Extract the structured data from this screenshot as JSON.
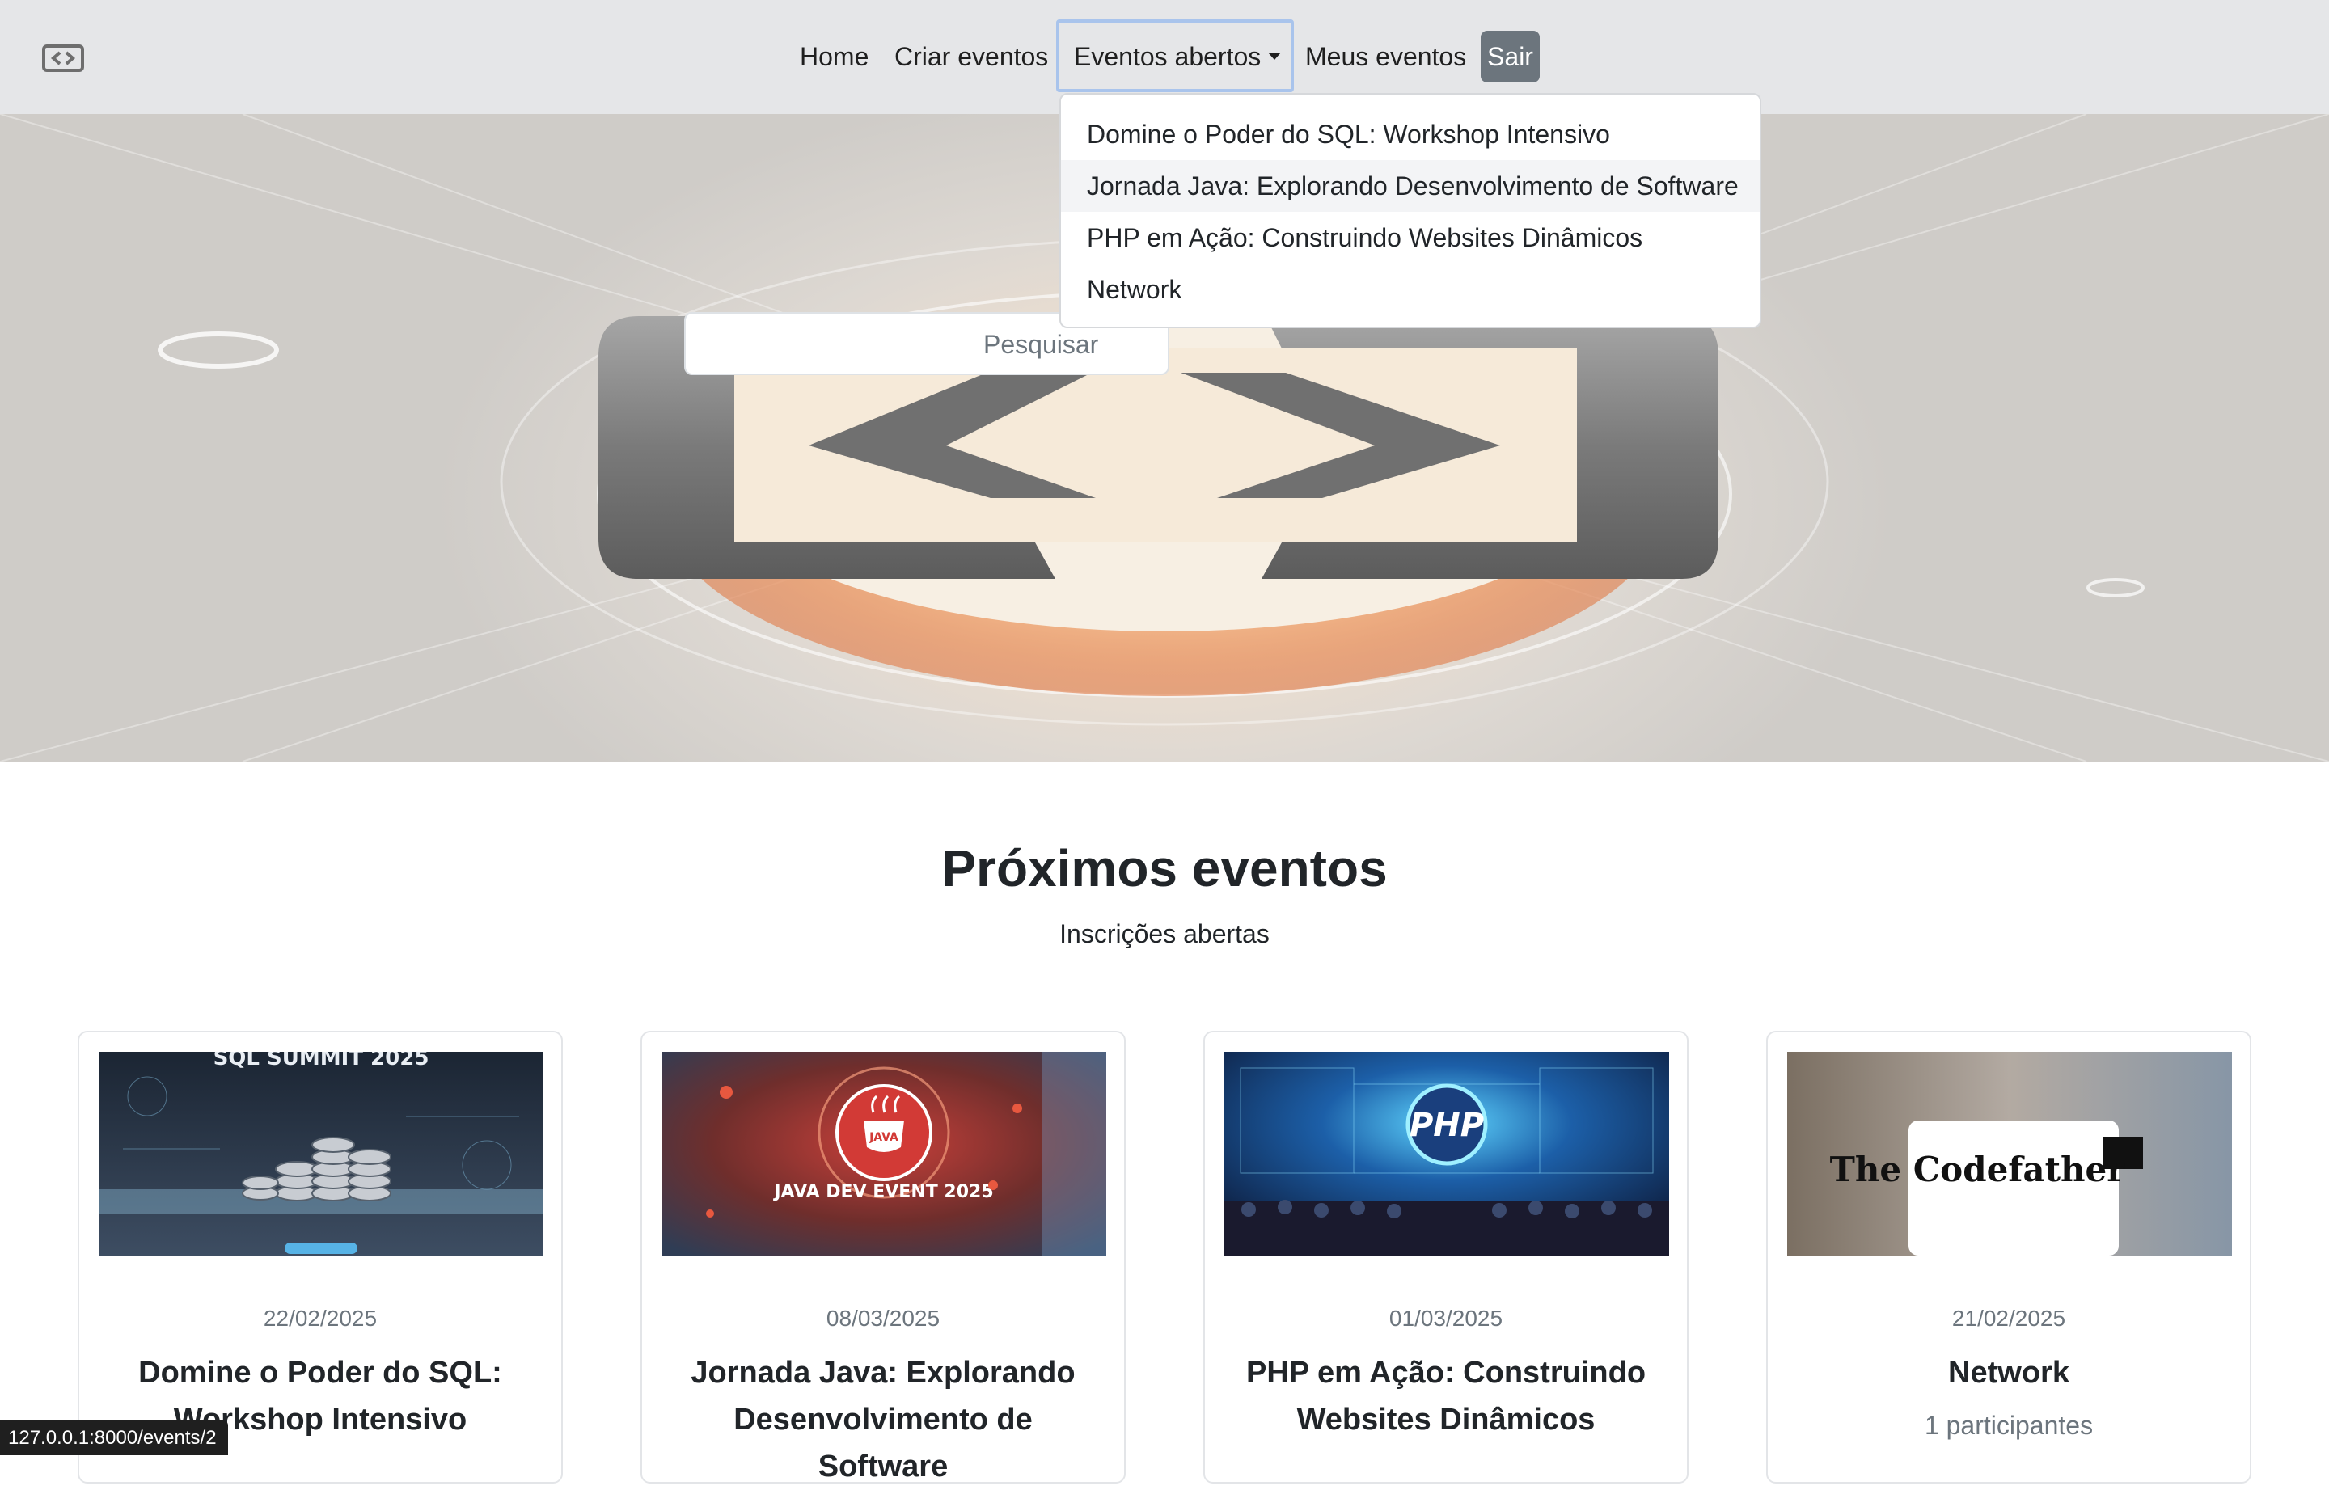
{
  "nav": {
    "logo_icon": "code-brackets-icon",
    "links": [
      {
        "label": "Home"
      },
      {
        "label": "Criar eventos"
      },
      {
        "label": "Meus eventos"
      }
    ],
    "dropdown_label": "Eventos abertos",
    "logout_label": "Sair"
  },
  "dropdown": {
    "items": [
      {
        "label": "Domine o Poder do SQL: Workshop Intensivo"
      },
      {
        "label": "Jornada Java: Explorando Desenvolvimento de Software"
      },
      {
        "label": "PHP em Ação: Construindo Websites Dinâmicos"
      },
      {
        "label": "Network"
      }
    ]
  },
  "hero": {
    "search_placeholder": "Pesquisar"
  },
  "section": {
    "title": "Próximos eventos",
    "subtitle": "Inscrições abertas"
  },
  "events": [
    {
      "date": "22/02/2025",
      "title": "Domine o Poder do SQL: Workshop Intensivo",
      "image_text": "SQL SUMMIT 2025"
    },
    {
      "date": "08/03/2025",
      "title": "Jornada Java: Explorando Desenvolvimento de Software",
      "image_text": "JAVA DEV EVENT 2025"
    },
    {
      "date": "01/03/2025",
      "title": "PHP em Ação: Construindo Websites Dinâmicos",
      "image_text": "PHP"
    },
    {
      "date": "21/02/2025",
      "title": "Network",
      "participants": "1 participantes",
      "image_text": "The Codefather"
    }
  ],
  "status_bar": {
    "url": "127.0.0.1:8000/events/2"
  }
}
